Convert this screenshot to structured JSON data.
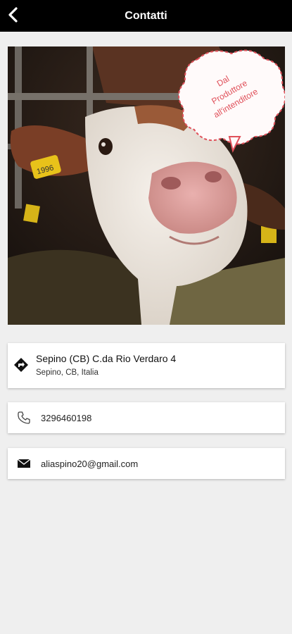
{
  "header": {
    "title": "Contatti",
    "back_icon": "chevron-left-icon"
  },
  "photo": {
    "ear_tag": "1996",
    "bubble_lines": [
      "Dal",
      "Produttore",
      "all'intenditore"
    ]
  },
  "address": {
    "icon": "directions-icon",
    "street": "Sepino (CB) C.da Rio Verdaro 4",
    "city": "Sepino, CB, Italia"
  },
  "phone": {
    "icon": "phone-icon",
    "number": "3296460198"
  },
  "email": {
    "icon": "mail-icon",
    "address": "aliaspino20@gmail.com"
  },
  "colors": {
    "header_bg": "#000000",
    "page_bg": "#efefef",
    "bubble_border": "#e0505a"
  }
}
